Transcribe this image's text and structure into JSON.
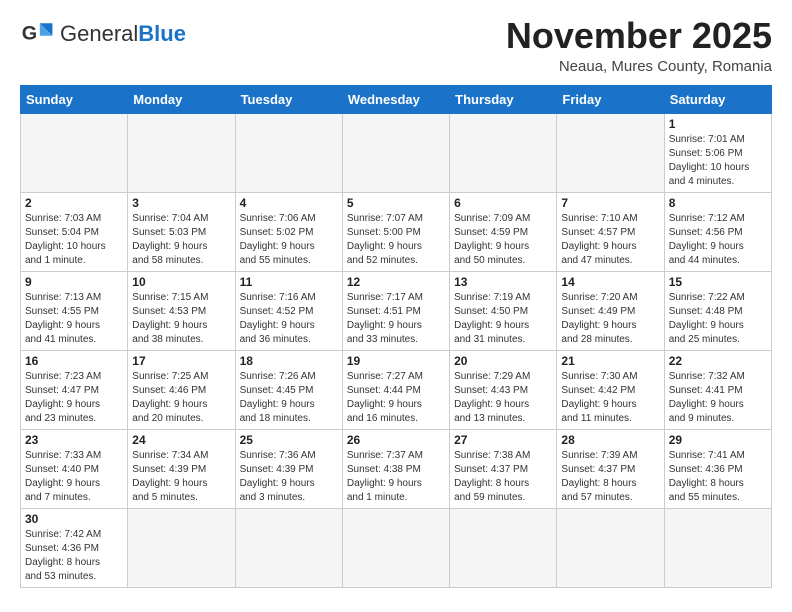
{
  "logo": {
    "general": "General",
    "blue": "Blue"
  },
  "title": "November 2025",
  "subtitle": "Neaua, Mures County, Romania",
  "days_of_week": [
    "Sunday",
    "Monday",
    "Tuesday",
    "Wednesday",
    "Thursday",
    "Friday",
    "Saturday"
  ],
  "weeks": [
    [
      {
        "day": "",
        "info": "",
        "empty": true
      },
      {
        "day": "",
        "info": "",
        "empty": true
      },
      {
        "day": "",
        "info": "",
        "empty": true
      },
      {
        "day": "",
        "info": "",
        "empty": true
      },
      {
        "day": "",
        "info": "",
        "empty": true
      },
      {
        "day": "",
        "info": "",
        "empty": true
      },
      {
        "day": "1",
        "info": "Sunrise: 7:01 AM\nSunset: 5:06 PM\nDaylight: 10 hours\nand 4 minutes."
      }
    ],
    [
      {
        "day": "2",
        "info": "Sunrise: 7:03 AM\nSunset: 5:04 PM\nDaylight: 10 hours\nand 1 minute."
      },
      {
        "day": "3",
        "info": "Sunrise: 7:04 AM\nSunset: 5:03 PM\nDaylight: 9 hours\nand 58 minutes."
      },
      {
        "day": "4",
        "info": "Sunrise: 7:06 AM\nSunset: 5:02 PM\nDaylight: 9 hours\nand 55 minutes."
      },
      {
        "day": "5",
        "info": "Sunrise: 7:07 AM\nSunset: 5:00 PM\nDaylight: 9 hours\nand 52 minutes."
      },
      {
        "day": "6",
        "info": "Sunrise: 7:09 AM\nSunset: 4:59 PM\nDaylight: 9 hours\nand 50 minutes."
      },
      {
        "day": "7",
        "info": "Sunrise: 7:10 AM\nSunset: 4:57 PM\nDaylight: 9 hours\nand 47 minutes."
      },
      {
        "day": "8",
        "info": "Sunrise: 7:12 AM\nSunset: 4:56 PM\nDaylight: 9 hours\nand 44 minutes."
      }
    ],
    [
      {
        "day": "9",
        "info": "Sunrise: 7:13 AM\nSunset: 4:55 PM\nDaylight: 9 hours\nand 41 minutes."
      },
      {
        "day": "10",
        "info": "Sunrise: 7:15 AM\nSunset: 4:53 PM\nDaylight: 9 hours\nand 38 minutes."
      },
      {
        "day": "11",
        "info": "Sunrise: 7:16 AM\nSunset: 4:52 PM\nDaylight: 9 hours\nand 36 minutes."
      },
      {
        "day": "12",
        "info": "Sunrise: 7:17 AM\nSunset: 4:51 PM\nDaylight: 9 hours\nand 33 minutes."
      },
      {
        "day": "13",
        "info": "Sunrise: 7:19 AM\nSunset: 4:50 PM\nDaylight: 9 hours\nand 31 minutes."
      },
      {
        "day": "14",
        "info": "Sunrise: 7:20 AM\nSunset: 4:49 PM\nDaylight: 9 hours\nand 28 minutes."
      },
      {
        "day": "15",
        "info": "Sunrise: 7:22 AM\nSunset: 4:48 PM\nDaylight: 9 hours\nand 25 minutes."
      }
    ],
    [
      {
        "day": "16",
        "info": "Sunrise: 7:23 AM\nSunset: 4:47 PM\nDaylight: 9 hours\nand 23 minutes."
      },
      {
        "day": "17",
        "info": "Sunrise: 7:25 AM\nSunset: 4:46 PM\nDaylight: 9 hours\nand 20 minutes."
      },
      {
        "day": "18",
        "info": "Sunrise: 7:26 AM\nSunset: 4:45 PM\nDaylight: 9 hours\nand 18 minutes."
      },
      {
        "day": "19",
        "info": "Sunrise: 7:27 AM\nSunset: 4:44 PM\nDaylight: 9 hours\nand 16 minutes."
      },
      {
        "day": "20",
        "info": "Sunrise: 7:29 AM\nSunset: 4:43 PM\nDaylight: 9 hours\nand 13 minutes."
      },
      {
        "day": "21",
        "info": "Sunrise: 7:30 AM\nSunset: 4:42 PM\nDaylight: 9 hours\nand 11 minutes."
      },
      {
        "day": "22",
        "info": "Sunrise: 7:32 AM\nSunset: 4:41 PM\nDaylight: 9 hours\nand 9 minutes."
      }
    ],
    [
      {
        "day": "23",
        "info": "Sunrise: 7:33 AM\nSunset: 4:40 PM\nDaylight: 9 hours\nand 7 minutes."
      },
      {
        "day": "24",
        "info": "Sunrise: 7:34 AM\nSunset: 4:39 PM\nDaylight: 9 hours\nand 5 minutes."
      },
      {
        "day": "25",
        "info": "Sunrise: 7:36 AM\nSunset: 4:39 PM\nDaylight: 9 hours\nand 3 minutes."
      },
      {
        "day": "26",
        "info": "Sunrise: 7:37 AM\nSunset: 4:38 PM\nDaylight: 9 hours\nand 1 minute."
      },
      {
        "day": "27",
        "info": "Sunrise: 7:38 AM\nSunset: 4:37 PM\nDaylight: 8 hours\nand 59 minutes."
      },
      {
        "day": "28",
        "info": "Sunrise: 7:39 AM\nSunset: 4:37 PM\nDaylight: 8 hours\nand 57 minutes."
      },
      {
        "day": "29",
        "info": "Sunrise: 7:41 AM\nSunset: 4:36 PM\nDaylight: 8 hours\nand 55 minutes."
      }
    ],
    [
      {
        "day": "30",
        "info": "Sunrise: 7:42 AM\nSunset: 4:36 PM\nDaylight: 8 hours\nand 53 minutes."
      },
      {
        "day": "",
        "info": "",
        "empty": true
      },
      {
        "day": "",
        "info": "",
        "empty": true
      },
      {
        "day": "",
        "info": "",
        "empty": true
      },
      {
        "day": "",
        "info": "",
        "empty": true
      },
      {
        "day": "",
        "info": "",
        "empty": true
      },
      {
        "day": "",
        "info": "",
        "empty": true
      }
    ]
  ]
}
